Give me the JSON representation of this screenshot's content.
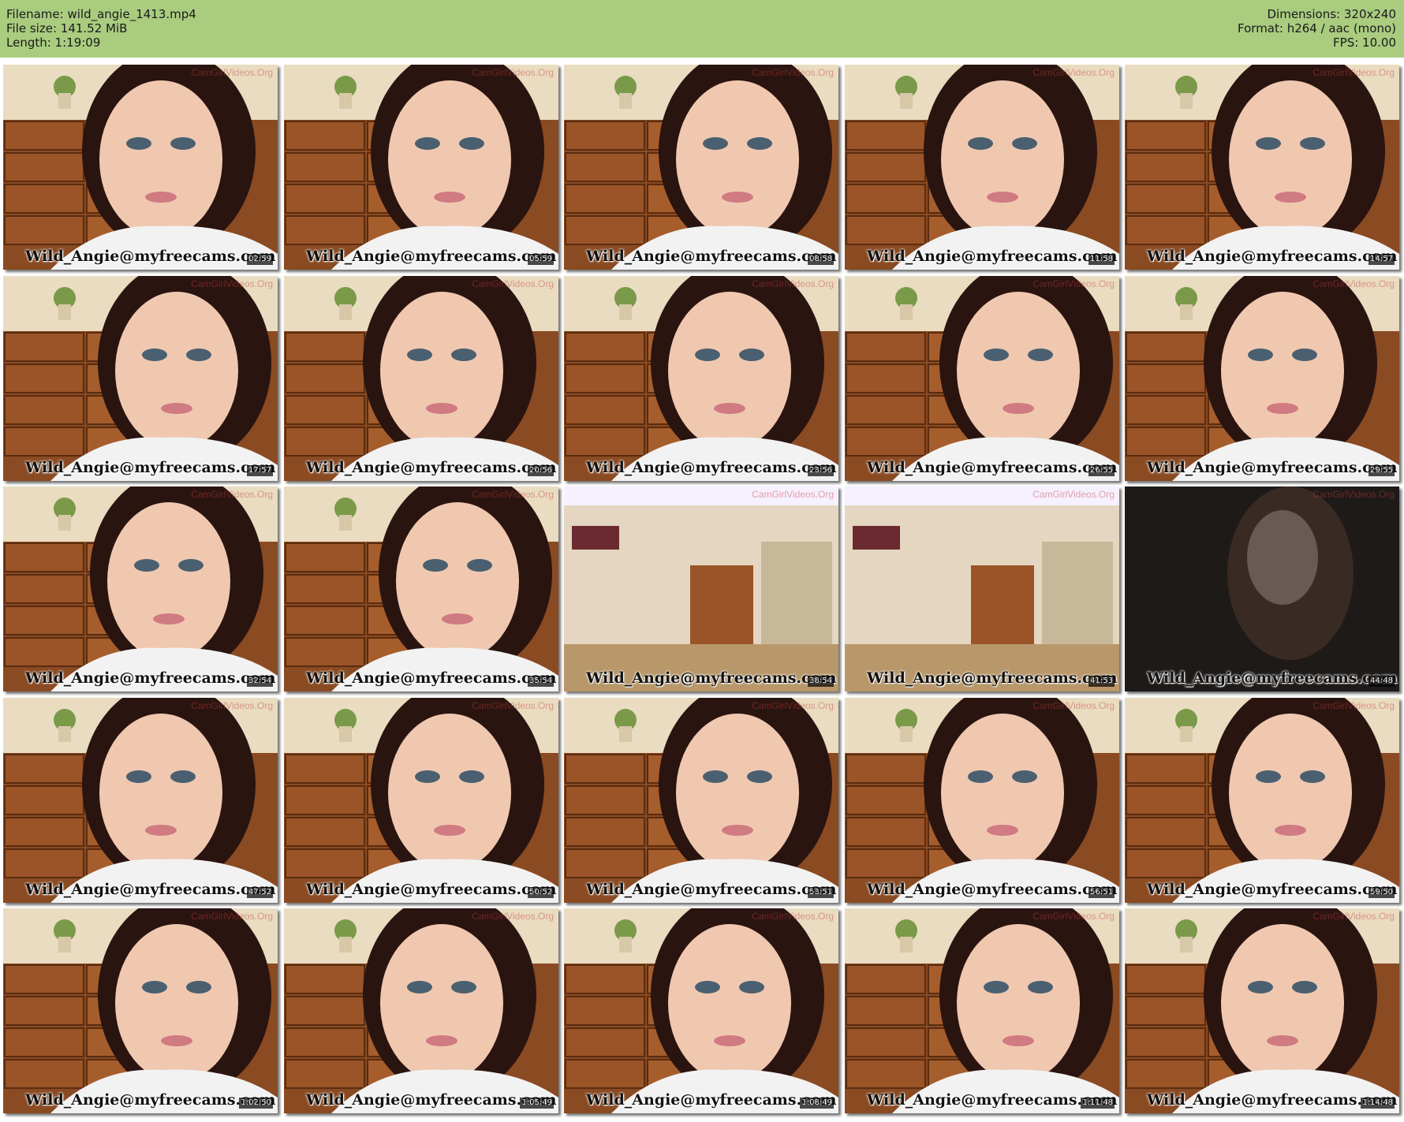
{
  "header": {
    "filename": "Filename: wild_angie_1413.mp4",
    "filesize": "File size: 141.52 MiB",
    "length": "Length: 1:19:09",
    "dimensions": "Dimensions: 320x240",
    "format": "Format: h264 / aac (mono)",
    "fps": "FPS: 10.00"
  },
  "colors": {
    "header_bg": "#a9cc7f"
  },
  "thumbnails": [
    {
      "timestamp": "02:59",
      "overlay": "Wild_Angie@myfreecams.com",
      "watermark": "CamGirlVideos.Org",
      "scene": "face"
    },
    {
      "timestamp": "05:59",
      "overlay": "Wild_Angie@myfreecams.com",
      "watermark": "CamGirlVideos.Org",
      "scene": "face"
    },
    {
      "timestamp": "08:58",
      "overlay": "Wild_Angie@myfreecams.com",
      "watermark": "CamGirlVideos.Org",
      "scene": "face"
    },
    {
      "timestamp": "11:58",
      "overlay": "Wild_Angie@myfreecams.com",
      "watermark": "CamGirlVideos.Org",
      "scene": "face"
    },
    {
      "timestamp": "14:57",
      "overlay": "Wild_Angie@myfreecams.com",
      "watermark": "CamGirlVideos.Org",
      "scene": "face"
    },
    {
      "timestamp": "17:57",
      "overlay": "Wild_Angie@myfreecams.com",
      "watermark": "CamGirlVideos.Org",
      "scene": "face"
    },
    {
      "timestamp": "20:56",
      "overlay": "Wild_Angie@myfreecams.com",
      "watermark": "CamGirlVideos.Org",
      "scene": "face"
    },
    {
      "timestamp": "23:56",
      "overlay": "Wild_Angie@myfreecams.com",
      "watermark": "CamGirlVideos.Org",
      "scene": "face"
    },
    {
      "timestamp": "26:55",
      "overlay": "Wild_Angie@myfreecams.com",
      "watermark": "CamGirlVideos.Org",
      "scene": "face"
    },
    {
      "timestamp": "29:55",
      "overlay": "Wild_Angie@myfreecams.com",
      "watermark": "CamGirlVideos.Org",
      "scene": "face"
    },
    {
      "timestamp": "32:54",
      "overlay": "Wild_Angie@myfreecams.com",
      "watermark": "CamGirlVideos.Org",
      "scene": "face"
    },
    {
      "timestamp": "35:54",
      "overlay": "Wild_Angie@myfreecams.com",
      "watermark": "CamGirlVideos.Org",
      "scene": "face"
    },
    {
      "timestamp": "38:54",
      "overlay": "Wild_Angie@myfreecams.com",
      "watermark": "CamGirlVideos.Org",
      "scene": "room"
    },
    {
      "timestamp": "41:53",
      "overlay": "Wild_Angie@myfreecams.com",
      "watermark": "CamGirlVideos.Org",
      "scene": "room"
    },
    {
      "timestamp": "44:48",
      "overlay": "Wild_Angie@myfreecams.com",
      "watermark": "CamGirlVideos.Org",
      "scene": "dark"
    },
    {
      "timestamp": "47:52",
      "overlay": "Wild_Angie@myfreecams.com",
      "watermark": "CamGirlVideos.Org",
      "scene": "face"
    },
    {
      "timestamp": "50:52",
      "overlay": "Wild_Angie@myfreecams.com",
      "watermark": "CamGirlVideos.Org",
      "scene": "face"
    },
    {
      "timestamp": "53:51",
      "overlay": "Wild_Angie@myfreecams.com",
      "watermark": "CamGirlVideos.Org",
      "scene": "face"
    },
    {
      "timestamp": "56:51",
      "overlay": "Wild_Angie@myfreecams.com",
      "watermark": "CamGirlVideos.Org",
      "scene": "face"
    },
    {
      "timestamp": "59:50",
      "overlay": "Wild_Angie@myfreecams.com",
      "watermark": "CamGirlVideos.Org",
      "scene": "face"
    },
    {
      "timestamp": "1:02:50",
      "overlay": "Wild_Angie@myfreecams.com",
      "watermark": "CamGirlVideos.Org",
      "scene": "face"
    },
    {
      "timestamp": "1:05:49",
      "overlay": "Wild_Angie@myfreecams.com",
      "watermark": "CamGirlVideos.Org",
      "scene": "face"
    },
    {
      "timestamp": "1:08:49",
      "overlay": "Wild_Angie@myfreecams.com",
      "watermark": "CamGirlVideos.Org",
      "scene": "face"
    },
    {
      "timestamp": "1:11:48",
      "overlay": "Wild_Angie@myfreecams.com",
      "watermark": "CamGirlVideos.Org",
      "scene": "face"
    },
    {
      "timestamp": "1:14:48",
      "overlay": "Wild_Angie@myfreecams.com",
      "watermark": "CamGirlVideos.Org",
      "scene": "face"
    }
  ]
}
